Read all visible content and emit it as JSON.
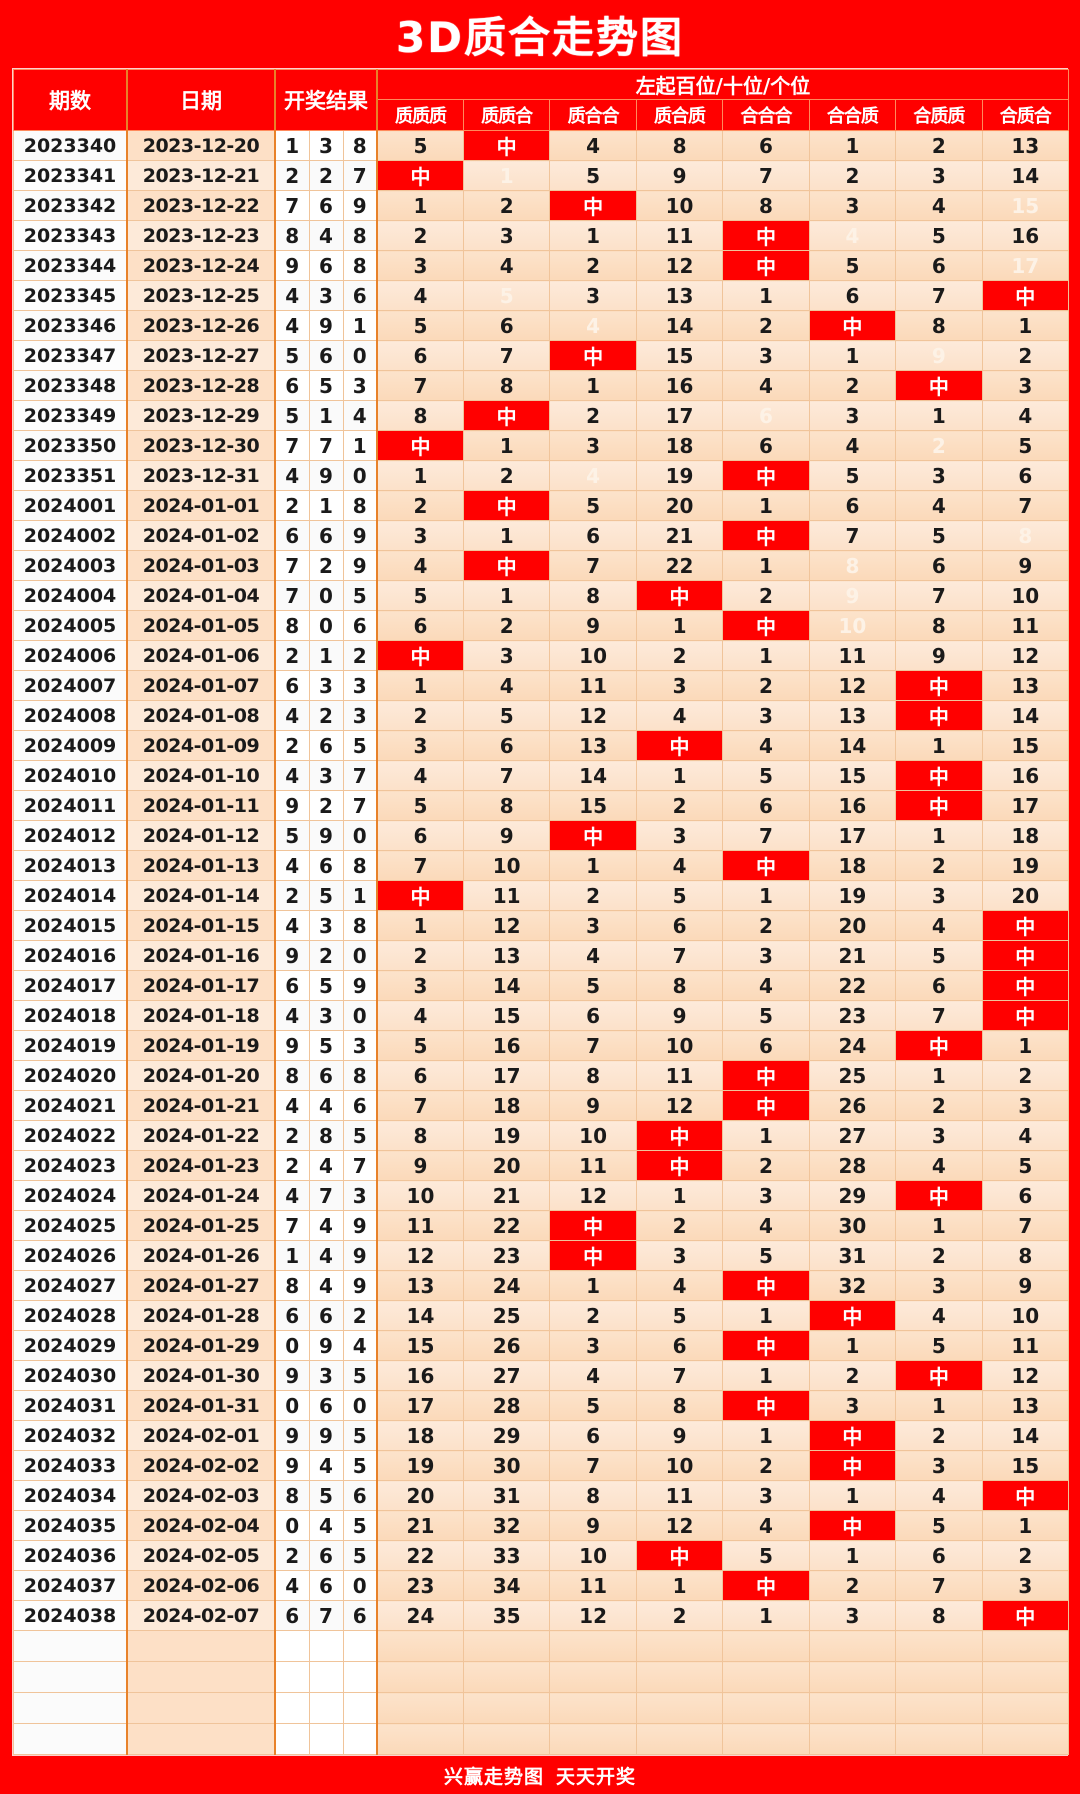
{
  "title": "3D质合走势图",
  "footer": {
    "left": "兴赢走势图",
    "right": "天天开奖"
  },
  "headers": {
    "period": "期数",
    "date": "日期",
    "result": "开奖结果",
    "group": "左起百位/十位/个位",
    "sub": [
      "质质质",
      "质质合",
      "质合合",
      "质合质",
      "合合合",
      "合合质",
      "合质质",
      "合质合"
    ]
  },
  "hit_label": "中",
  "colors": {
    "brand_red": "#FF0000",
    "hit_bg": "#FF0000",
    "hit_text": "#FFFFFF",
    "cell_bg": "#FCE3CB",
    "date_bg": "#FDE0C6",
    "ball_bg": "#FFFFFF",
    "grid_line": "#F0C49A",
    "separator": "#E8822A"
  },
  "empty_rows": 4,
  "chart_data": {
    "type": "table",
    "title": "3D质合走势图",
    "columns": [
      "期数",
      "日期",
      "开奖结果",
      "质质质",
      "质质合",
      "质合合",
      "质合质",
      "合合合",
      "合合质",
      "合质质",
      "合质合"
    ],
    "rows": [
      {
        "period": "2023340",
        "date": "2023-12-20",
        "balls": [
          1,
          3,
          8
        ],
        "miss": [
          "5",
          "中",
          "4",
          "8",
          "6",
          "1",
          "2",
          "13"
        ],
        "faded": []
      },
      {
        "period": "2023341",
        "date": "2023-12-21",
        "balls": [
          2,
          2,
          7
        ],
        "miss": [
          "中",
          "1",
          "5",
          "9",
          "7",
          "2",
          "3",
          "14"
        ],
        "faded": [
          1
        ]
      },
      {
        "period": "2023342",
        "date": "2023-12-22",
        "balls": [
          7,
          6,
          9
        ],
        "miss": [
          "1",
          "2",
          "中",
          "10",
          "8",
          "3",
          "4",
          "15"
        ],
        "faded": [
          7
        ]
      },
      {
        "period": "2023343",
        "date": "2023-12-23",
        "balls": [
          8,
          4,
          8
        ],
        "miss": [
          "2",
          "3",
          "1",
          "11",
          "中",
          "4",
          "5",
          "16"
        ],
        "faded": [
          5
        ]
      },
      {
        "period": "2023344",
        "date": "2023-12-24",
        "balls": [
          9,
          6,
          8
        ],
        "miss": [
          "3",
          "4",
          "2",
          "12",
          "中",
          "5",
          "6",
          "17"
        ],
        "faded": [
          7
        ]
      },
      {
        "period": "2023345",
        "date": "2023-12-25",
        "balls": [
          4,
          3,
          6
        ],
        "miss": [
          "4",
          "5",
          "3",
          "13",
          "1",
          "6",
          "7",
          "中"
        ],
        "faded": [
          1
        ]
      },
      {
        "period": "2023346",
        "date": "2023-12-26",
        "balls": [
          4,
          9,
          1
        ],
        "miss": [
          "5",
          "6",
          "4",
          "14",
          "2",
          "中",
          "8",
          "1"
        ],
        "faded": [
          2
        ]
      },
      {
        "period": "2023347",
        "date": "2023-12-27",
        "balls": [
          5,
          6,
          0
        ],
        "miss": [
          "6",
          "7",
          "中",
          "15",
          "3",
          "1",
          "9",
          "2"
        ],
        "faded": [
          6
        ]
      },
      {
        "period": "2023348",
        "date": "2023-12-28",
        "balls": [
          6,
          5,
          3
        ],
        "miss": [
          "7",
          "8",
          "1",
          "16",
          "4",
          "2",
          "中",
          "3"
        ],
        "faded": []
      },
      {
        "period": "2023349",
        "date": "2023-12-29",
        "balls": [
          5,
          1,
          4
        ],
        "miss": [
          "8",
          "中",
          "2",
          "17",
          "6",
          "3",
          "1",
          "4"
        ],
        "faded": [
          4
        ]
      },
      {
        "period": "2023350",
        "date": "2023-12-30",
        "balls": [
          7,
          7,
          1
        ],
        "miss": [
          "中",
          "1",
          "3",
          "18",
          "6",
          "4",
          "2",
          "5"
        ],
        "faded": [
          6
        ]
      },
      {
        "period": "2023351",
        "date": "2023-12-31",
        "balls": [
          4,
          9,
          0
        ],
        "miss": [
          "1",
          "2",
          "4",
          "19",
          "中",
          "5",
          "3",
          "6"
        ],
        "faded": [
          2
        ]
      },
      {
        "period": "2024001",
        "date": "2024-01-01",
        "balls": [
          2,
          1,
          8
        ],
        "miss": [
          "2",
          "中",
          "5",
          "20",
          "1",
          "6",
          "4",
          "7"
        ],
        "faded": []
      },
      {
        "period": "2024002",
        "date": "2024-01-02",
        "balls": [
          6,
          6,
          9
        ],
        "miss": [
          "3",
          "1",
          "6",
          "21",
          "中",
          "7",
          "5",
          "8"
        ],
        "faded": [
          7
        ]
      },
      {
        "period": "2024003",
        "date": "2024-01-03",
        "balls": [
          7,
          2,
          9
        ],
        "miss": [
          "4",
          "中",
          "7",
          "22",
          "1",
          "8",
          "6",
          "9"
        ],
        "faded": [
          5
        ]
      },
      {
        "period": "2024004",
        "date": "2024-01-04",
        "balls": [
          7,
          0,
          5
        ],
        "miss": [
          "5",
          "1",
          "8",
          "中",
          "2",
          "9",
          "7",
          "10"
        ],
        "faded": [
          5
        ]
      },
      {
        "period": "2024005",
        "date": "2024-01-05",
        "balls": [
          8,
          0,
          6
        ],
        "miss": [
          "6",
          "2",
          "9",
          "1",
          "中",
          "10",
          "8",
          "11"
        ],
        "faded": [
          5
        ]
      },
      {
        "period": "2024006",
        "date": "2024-01-06",
        "balls": [
          2,
          1,
          2
        ],
        "miss": [
          "中",
          "3",
          "10",
          "2",
          "1",
          "11",
          "9",
          "12"
        ],
        "faded": []
      },
      {
        "period": "2024007",
        "date": "2024-01-07",
        "balls": [
          6,
          3,
          3
        ],
        "miss": [
          "1",
          "4",
          "11",
          "3",
          "2",
          "12",
          "中",
          "13"
        ],
        "faded": []
      },
      {
        "period": "2024008",
        "date": "2024-01-08",
        "balls": [
          4,
          2,
          3
        ],
        "miss": [
          "2",
          "5",
          "12",
          "4",
          "3",
          "13",
          "中",
          "14"
        ],
        "faded": []
      },
      {
        "period": "2024009",
        "date": "2024-01-09",
        "balls": [
          2,
          6,
          5
        ],
        "miss": [
          "3",
          "6",
          "13",
          "中",
          "4",
          "14",
          "1",
          "15"
        ],
        "faded": []
      },
      {
        "period": "2024010",
        "date": "2024-01-10",
        "balls": [
          4,
          3,
          7
        ],
        "miss": [
          "4",
          "7",
          "14",
          "1",
          "5",
          "15",
          "中",
          "16"
        ],
        "faded": []
      },
      {
        "period": "2024011",
        "date": "2024-01-11",
        "balls": [
          9,
          2,
          7
        ],
        "miss": [
          "5",
          "8",
          "15",
          "2",
          "6",
          "16",
          "中",
          "17"
        ],
        "faded": []
      },
      {
        "period": "2024012",
        "date": "2024-01-12",
        "balls": [
          5,
          9,
          0
        ],
        "miss": [
          "6",
          "9",
          "中",
          "3",
          "7",
          "17",
          "1",
          "18"
        ],
        "faded": []
      },
      {
        "period": "2024013",
        "date": "2024-01-13",
        "balls": [
          4,
          6,
          8
        ],
        "miss": [
          "7",
          "10",
          "1",
          "4",
          "中",
          "18",
          "2",
          "19"
        ],
        "faded": []
      },
      {
        "period": "2024014",
        "date": "2024-01-14",
        "balls": [
          2,
          5,
          1
        ],
        "miss": [
          "中",
          "11",
          "2",
          "5",
          "1",
          "19",
          "3",
          "20"
        ],
        "faded": []
      },
      {
        "period": "2024015",
        "date": "2024-01-15",
        "balls": [
          4,
          3,
          8
        ],
        "miss": [
          "1",
          "12",
          "3",
          "6",
          "2",
          "20",
          "4",
          "中"
        ],
        "faded": []
      },
      {
        "period": "2024016",
        "date": "2024-01-16",
        "balls": [
          9,
          2,
          0
        ],
        "miss": [
          "2",
          "13",
          "4",
          "7",
          "3",
          "21",
          "5",
          "中"
        ],
        "faded": []
      },
      {
        "period": "2024017",
        "date": "2024-01-17",
        "balls": [
          6,
          5,
          9
        ],
        "miss": [
          "3",
          "14",
          "5",
          "8",
          "4",
          "22",
          "6",
          "中"
        ],
        "faded": []
      },
      {
        "period": "2024018",
        "date": "2024-01-18",
        "balls": [
          4,
          3,
          0
        ],
        "miss": [
          "4",
          "15",
          "6",
          "9",
          "5",
          "23",
          "7",
          "中"
        ],
        "faded": []
      },
      {
        "period": "2024019",
        "date": "2024-01-19",
        "balls": [
          9,
          5,
          3
        ],
        "miss": [
          "5",
          "16",
          "7",
          "10",
          "6",
          "24",
          "中",
          "1"
        ],
        "faded": []
      },
      {
        "period": "2024020",
        "date": "2024-01-20",
        "balls": [
          8,
          6,
          8
        ],
        "miss": [
          "6",
          "17",
          "8",
          "11",
          "中",
          "25",
          "1",
          "2"
        ],
        "faded": []
      },
      {
        "period": "2024021",
        "date": "2024-01-21",
        "balls": [
          4,
          4,
          6
        ],
        "miss": [
          "7",
          "18",
          "9",
          "12",
          "中",
          "26",
          "2",
          "3"
        ],
        "faded": []
      },
      {
        "period": "2024022",
        "date": "2024-01-22",
        "balls": [
          2,
          8,
          5
        ],
        "miss": [
          "8",
          "19",
          "10",
          "中",
          "1",
          "27",
          "3",
          "4"
        ],
        "faded": []
      },
      {
        "period": "2024023",
        "date": "2024-01-23",
        "balls": [
          2,
          4,
          7
        ],
        "miss": [
          "9",
          "20",
          "11",
          "中",
          "2",
          "28",
          "4",
          "5"
        ],
        "faded": []
      },
      {
        "period": "2024024",
        "date": "2024-01-24",
        "balls": [
          4,
          7,
          3
        ],
        "miss": [
          "10",
          "21",
          "12",
          "1",
          "3",
          "29",
          "中",
          "6"
        ],
        "faded": []
      },
      {
        "period": "2024025",
        "date": "2024-01-25",
        "balls": [
          7,
          4,
          9
        ],
        "miss": [
          "11",
          "22",
          "中",
          "2",
          "4",
          "30",
          "1",
          "7"
        ],
        "faded": []
      },
      {
        "period": "2024026",
        "date": "2024-01-26",
        "balls": [
          1,
          4,
          9
        ],
        "miss": [
          "12",
          "23",
          "中",
          "3",
          "5",
          "31",
          "2",
          "8"
        ],
        "faded": []
      },
      {
        "period": "2024027",
        "date": "2024-01-27",
        "balls": [
          8,
          4,
          9
        ],
        "miss": [
          "13",
          "24",
          "1",
          "4",
          "中",
          "32",
          "3",
          "9"
        ],
        "faded": []
      },
      {
        "period": "2024028",
        "date": "2024-01-28",
        "balls": [
          6,
          6,
          2
        ],
        "miss": [
          "14",
          "25",
          "2",
          "5",
          "1",
          "中",
          "4",
          "10"
        ],
        "faded": []
      },
      {
        "period": "2024029",
        "date": "2024-01-29",
        "balls": [
          0,
          9,
          4
        ],
        "miss": [
          "15",
          "26",
          "3",
          "6",
          "中",
          "1",
          "5",
          "11"
        ],
        "faded": []
      },
      {
        "period": "2024030",
        "date": "2024-01-30",
        "balls": [
          9,
          3,
          5
        ],
        "miss": [
          "16",
          "27",
          "4",
          "7",
          "1",
          "2",
          "中",
          "12"
        ],
        "faded": []
      },
      {
        "period": "2024031",
        "date": "2024-01-31",
        "balls": [
          0,
          6,
          0
        ],
        "miss": [
          "17",
          "28",
          "5",
          "8",
          "中",
          "3",
          "1",
          "13"
        ],
        "faded": []
      },
      {
        "period": "2024032",
        "date": "2024-02-01",
        "balls": [
          9,
          9,
          5
        ],
        "miss": [
          "18",
          "29",
          "6",
          "9",
          "1",
          "中",
          "2",
          "14"
        ],
        "faded": []
      },
      {
        "period": "2024033",
        "date": "2024-02-02",
        "balls": [
          9,
          4,
          5
        ],
        "miss": [
          "19",
          "30",
          "7",
          "10",
          "2",
          "中",
          "3",
          "15"
        ],
        "faded": []
      },
      {
        "period": "2024034",
        "date": "2024-02-03",
        "balls": [
          8,
          5,
          6
        ],
        "miss": [
          "20",
          "31",
          "8",
          "11",
          "3",
          "1",
          "4",
          "中"
        ],
        "faded": []
      },
      {
        "period": "2024035",
        "date": "2024-02-04",
        "balls": [
          0,
          4,
          5
        ],
        "miss": [
          "21",
          "32",
          "9",
          "12",
          "4",
          "中",
          "5",
          "1"
        ],
        "faded": []
      },
      {
        "period": "2024036",
        "date": "2024-02-05",
        "balls": [
          2,
          6,
          5
        ],
        "miss": [
          "22",
          "33",
          "10",
          "中",
          "5",
          "1",
          "6",
          "2"
        ],
        "faded": []
      },
      {
        "period": "2024037",
        "date": "2024-02-06",
        "balls": [
          4,
          6,
          0
        ],
        "miss": [
          "23",
          "34",
          "11",
          "1",
          "中",
          "2",
          "7",
          "3"
        ],
        "faded": []
      },
      {
        "period": "2024038",
        "date": "2024-02-07",
        "balls": [
          6,
          7,
          6
        ],
        "miss": [
          "24",
          "35",
          "12",
          "2",
          "1",
          "3",
          "8",
          "中"
        ],
        "faded": []
      }
    ]
  }
}
